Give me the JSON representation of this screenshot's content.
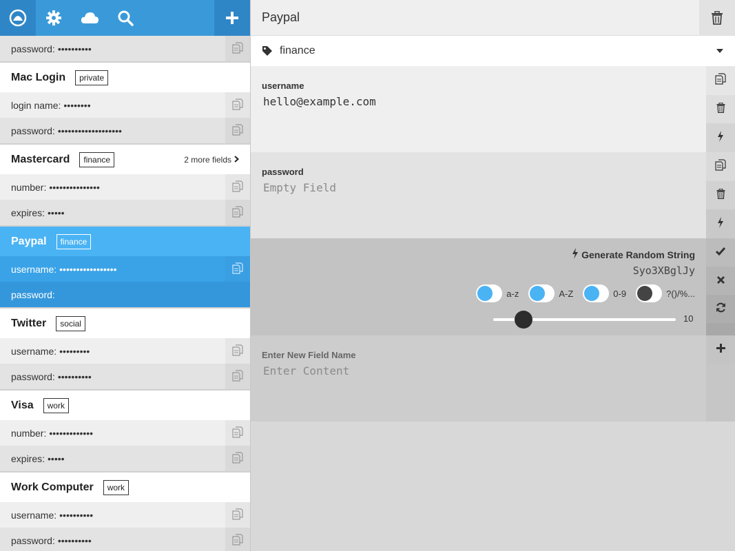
{
  "toolbar": {
    "items": [
      {
        "icon": "user-circle-icon",
        "active": true
      },
      {
        "icon": "gear-icon",
        "active": false
      },
      {
        "icon": "cloud-icon",
        "active": false
      },
      {
        "icon": "search-icon",
        "active": false
      }
    ],
    "add_icon": "plus-icon"
  },
  "entries": [
    {
      "title": "",
      "tag": "",
      "fields": [
        {
          "label": "password:",
          "value": "••••••••••"
        }
      ]
    },
    {
      "title": "Mac Login",
      "tag": "private",
      "fields": [
        {
          "label": "login name:",
          "value": "••••••••"
        },
        {
          "label": "password:",
          "value": "•••••••••••••••••••"
        }
      ]
    },
    {
      "title": "Mastercard",
      "tag": "finance",
      "more": "2 more fields",
      "fields": [
        {
          "label": "number:",
          "value": "•••••••••••••••"
        },
        {
          "label": "expires:",
          "value": "•••••"
        }
      ]
    },
    {
      "title": "Paypal",
      "tag": "finance",
      "selected": true,
      "fields": [
        {
          "label": "username:",
          "value": "•••••••••••••••••"
        },
        {
          "label": "password:",
          "value": ""
        }
      ]
    },
    {
      "title": "Twitter",
      "tag": "social",
      "fields": [
        {
          "label": "username:",
          "value": "•••••••••"
        },
        {
          "label": "password:",
          "value": "••••••••••"
        }
      ]
    },
    {
      "title": "Visa",
      "tag": "work",
      "fields": [
        {
          "label": "number:",
          "value": "•••••••••••••"
        },
        {
          "label": "expires:",
          "value": "•••••"
        }
      ]
    },
    {
      "title": "Work Computer",
      "tag": "work",
      "fields": [
        {
          "label": "username:",
          "value": "••••••••••"
        },
        {
          "label": "password:",
          "value": "••••••••••"
        }
      ]
    }
  ],
  "detail": {
    "title": "Paypal",
    "tag": "finance",
    "username": {
      "label": "username",
      "value": "hello@example.com"
    },
    "password": {
      "label": "password",
      "placeholder": "Empty Field"
    },
    "generator": {
      "title": "Generate Random String",
      "value": "Syo3XBglJy",
      "options": [
        {
          "label": "a-z",
          "on": true
        },
        {
          "label": "A-Z",
          "on": true
        },
        {
          "label": "0-9",
          "on": true
        },
        {
          "label": "?()/%...",
          "on": false
        }
      ],
      "length": "10",
      "slider_fraction": 0.13
    },
    "new_field": {
      "label": "Enter New Field Name",
      "placeholder": "Enter Content"
    }
  },
  "colors": {
    "accent": "#3a9ad9",
    "selected": "#4ab3f4"
  }
}
